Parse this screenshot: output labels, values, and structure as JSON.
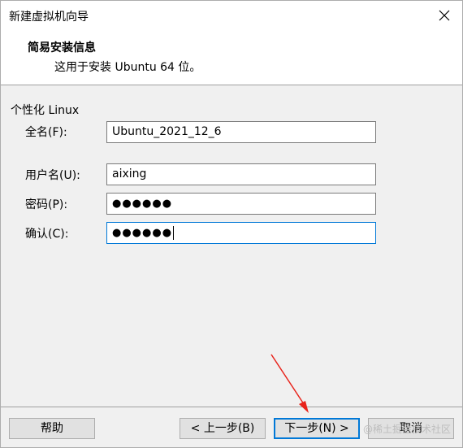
{
  "window": {
    "title": "新建虚拟机向导"
  },
  "header": {
    "title": "简易安装信息",
    "subtitle": "这用于安装 Ubuntu 64 位。"
  },
  "personalize": {
    "group_label": "个性化 Linux",
    "full_name_label": "全名(F):",
    "full_name_value": "Ubuntu_2021_12_6",
    "username_label": "用户名(U):",
    "username_value": "aixing",
    "password_label": "密码(P):",
    "password_value": "●●●●●●",
    "confirm_label": "确认(C):",
    "confirm_value": "●●●●●●"
  },
  "footer": {
    "help_label": "帮助",
    "back_label": "< 上一步(B)",
    "next_label": "下一步(N) >",
    "cancel_label": "取消"
  },
  "watermark": "@稀土掘金技术社区",
  "colors": {
    "focus_border": "#0078d7",
    "annotation_arrow": "#e8231b"
  }
}
